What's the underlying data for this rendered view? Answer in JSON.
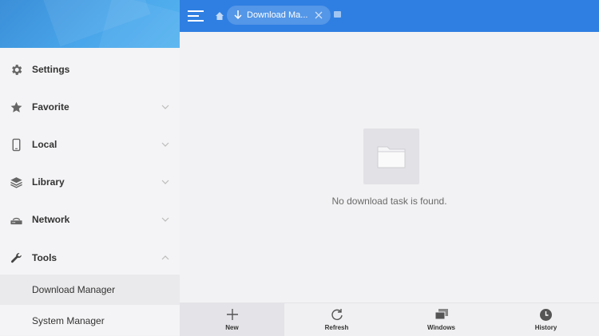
{
  "sidebar": {
    "items": [
      {
        "label": "Settings",
        "icon": "gear-icon",
        "expandable": false
      },
      {
        "label": "Favorite",
        "icon": "star-icon",
        "expandable": true,
        "expanded": false
      },
      {
        "label": "Local",
        "icon": "phone-icon",
        "expandable": true,
        "expanded": false
      },
      {
        "label": "Library",
        "icon": "stack-icon",
        "expandable": true,
        "expanded": false
      },
      {
        "label": "Network",
        "icon": "network-icon",
        "expandable": true,
        "expanded": false
      },
      {
        "label": "Tools",
        "icon": "wrench-icon",
        "expandable": true,
        "expanded": true
      }
    ],
    "subitems": [
      {
        "label": "Download Manager",
        "active": true
      },
      {
        "label": "System Manager",
        "active": false
      }
    ]
  },
  "topbar": {
    "tab_label": "Download Ma...",
    "accent": "#2f7fe2"
  },
  "main": {
    "empty_message": "No download task is found."
  },
  "toolbar": {
    "items": [
      {
        "label": "New",
        "icon": "plus-icon",
        "active": true
      },
      {
        "label": "Refresh",
        "icon": "refresh-icon",
        "active": false
      },
      {
        "label": "Windows",
        "icon": "windows-icon",
        "active": false
      },
      {
        "label": "History",
        "icon": "clock-icon",
        "active": false
      }
    ]
  }
}
